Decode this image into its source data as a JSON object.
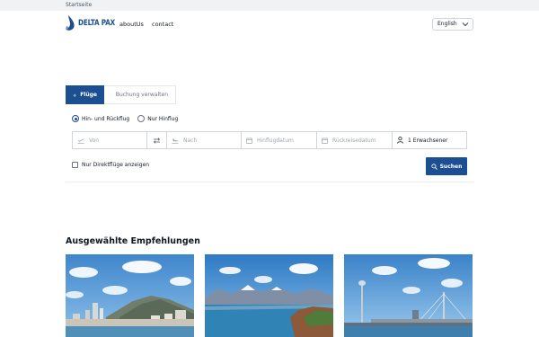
{
  "topbar": {
    "breadcrumb": "Startseite"
  },
  "nav": {
    "logo_text": "DELTA PAX",
    "links": [
      "aboutUs",
      "contact"
    ],
    "language": "English"
  },
  "tabs": {
    "flights": "Flüge",
    "manage_booking": "Buchung verwalten"
  },
  "trip_type": {
    "round_trip": "Hin- und Rückflug",
    "one_way": "Nur Hinflug",
    "selected": "round_trip"
  },
  "search": {
    "from_placeholder": "Von",
    "to_placeholder": "Nach",
    "depart_placeholder": "Hinflugdatum",
    "return_placeholder": "Rückreisedatum",
    "passengers": "1 Erwachsener",
    "direct_only_label": "Nur Direktflüge anzeigen",
    "submit_label": "Suchen"
  },
  "recommendations": {
    "title": "Ausgewählte Empfehlungen"
  },
  "colors": {
    "brand": "#1c4f91",
    "topbar": "#f1f2f4",
    "border": "#d1d5db"
  },
  "icons": [
    "logo-icon",
    "plane-icon",
    "calendar-icon",
    "takeoff-icon",
    "landing-icon",
    "swap-icon",
    "user-icon",
    "search-icon",
    "chevron-down-icon"
  ]
}
